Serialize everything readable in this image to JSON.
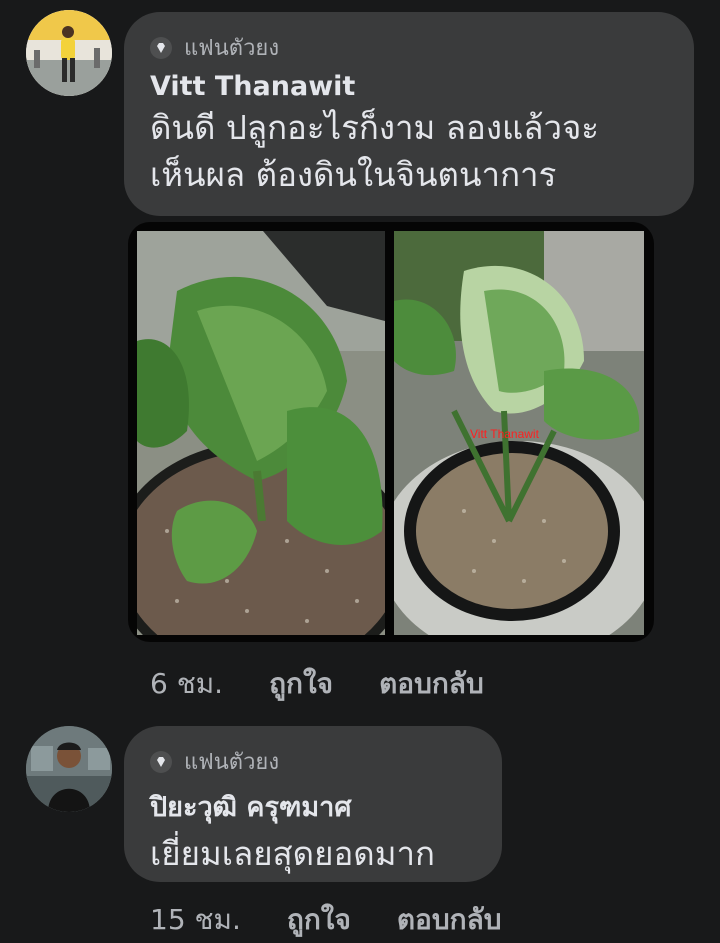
{
  "comments": [
    {
      "badge": "แฟนตัวยง",
      "author": "Vitt Thanawit",
      "text_lines": [
        "ดินดี ปลูกอะไรก็งาม ลองแล้วจะ",
        "เห็นผล ต้องดินในจินตนาการ"
      ],
      "time": "6 ชม.",
      "like_label": "ถูกใจ",
      "reply_label": "ตอบกลับ",
      "photo_watermark": "Vitt Thanawit"
    },
    {
      "badge": "แฟนตัวยง",
      "author": "ปิยะวุฒิ ครุฑมาศ",
      "text_lines": [
        "เยี่ยมเลยสุดยอดมาก"
      ],
      "time": "15 ชม.",
      "like_label": "ถูกใจ",
      "reply_label": "ตอบกลับ"
    }
  ],
  "colors": {
    "background": "#18191a",
    "bubble": "#3a3b3c",
    "secondary_text": "#b0b3b8",
    "primary_text": "#e4e6eb"
  }
}
